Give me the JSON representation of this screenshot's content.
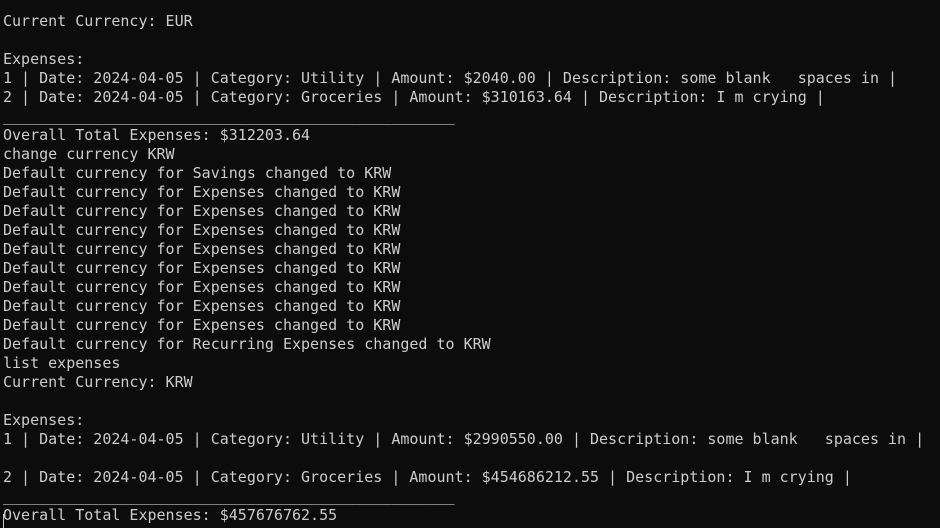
{
  "terminal": {
    "lines": [
      "",
      "Current Currency: EUR",
      "",
      "Expenses:",
      "1 | Date: 2024-04-05 | Category: Utility | Amount: $2040.00 | Description: some blank   spaces in |",
      "2 | Date: 2024-04-05 | Category: Groceries | Amount: $310163.64 | Description: I m crying |",
      "__________________________________________________",
      "Overall Total Expenses: $312203.64",
      "change currency KRW",
      "Default currency for Savings changed to KRW",
      "Default currency for Expenses changed to KRW",
      "Default currency for Expenses changed to KRW",
      "Default currency for Expenses changed to KRW",
      "Default currency for Expenses changed to KRW",
      "Default currency for Expenses changed to KRW",
      "Default currency for Expenses changed to KRW",
      "Default currency for Expenses changed to KRW",
      "Default currency for Expenses changed to KRW",
      "Default currency for Recurring Expenses changed to KRW",
      "list expenses",
      "Current Currency: KRW",
      "",
      "Expenses:",
      "1 | Date: 2024-04-05 | Category: Utility | Amount: $2990550.00 | Description: some blank   spaces in |",
      "",
      "2 | Date: 2024-04-05 | Category: Groceries | Amount: $454686212.55 | Description: I m crying |",
      "__________________________________________________",
      "Overall Total Expenses: $457676762.55"
    ]
  },
  "colors": {
    "background": "#0c0c0c",
    "foreground": "#cccccc"
  }
}
